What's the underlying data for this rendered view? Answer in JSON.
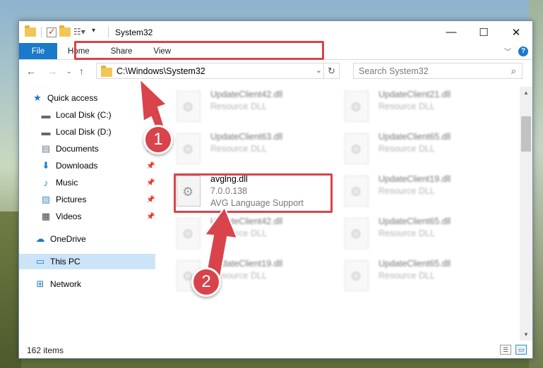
{
  "window": {
    "title": "System32",
    "controls": {
      "minimize": "—",
      "maximize": "☐",
      "close": "✕"
    }
  },
  "ribbon": {
    "tabs": [
      "File",
      "Home",
      "Share",
      "View"
    ]
  },
  "nav": {
    "address": "C:\\Windows\\System32",
    "search_placeholder": "Search System32"
  },
  "sidebar": {
    "items": [
      {
        "label": "Quick access",
        "icon": "star-icon",
        "pinned": false
      },
      {
        "label": "Local Disk (C:)",
        "icon": "drive-icon",
        "pinned": true
      },
      {
        "label": "Local Disk (D:)",
        "icon": "drive-icon",
        "pinned": true
      },
      {
        "label": "Documents",
        "icon": "documents-icon",
        "pinned": true
      },
      {
        "label": "Downloads",
        "icon": "download-icon",
        "pinned": true
      },
      {
        "label": "Music",
        "icon": "music-icon",
        "pinned": true
      },
      {
        "label": "Pictures",
        "icon": "pictures-icon",
        "pinned": true
      },
      {
        "label": "Videos",
        "icon": "videos-icon",
        "pinned": true
      },
      {
        "label": "OneDrive",
        "icon": "cloud-icon",
        "pinned": false
      },
      {
        "label": "This PC",
        "icon": "computer-icon",
        "pinned": false
      },
      {
        "label": "Network",
        "icon": "network-icon",
        "pinned": false
      }
    ]
  },
  "files": [
    {
      "name": "UpdateClient42.dll",
      "type": "Resource DLL"
    },
    {
      "name": "UpdateClient21.dll",
      "type": "Resource DLL"
    },
    {
      "name": "UpdateClient63.dll",
      "type": "Resource DLL"
    },
    {
      "name": "UpdateClient65.dll",
      "type": "Resource DLL"
    },
    {
      "name": "avglng.dll",
      "version": "7.0.0.138",
      "type": "AVG Language Support"
    },
    {
      "name": "UpdateClient19.dll",
      "type": "Resource DLL"
    },
    {
      "name": "UpdateClient42.dll",
      "type": "Resource DLL"
    },
    {
      "name": "UpdateClient65.dll",
      "type": "Resource DLL"
    },
    {
      "name": "UpdateClient19.dll",
      "type": "Resource DLL"
    },
    {
      "name": "UpdateClient65.dll",
      "type": "Resource DLL"
    }
  ],
  "status": {
    "item_count": "162 items"
  },
  "callouts": [
    "1",
    "2"
  ],
  "colors": {
    "accent": "#1979ca",
    "highlight": "#d9434b",
    "selected": "#cce4f7"
  }
}
